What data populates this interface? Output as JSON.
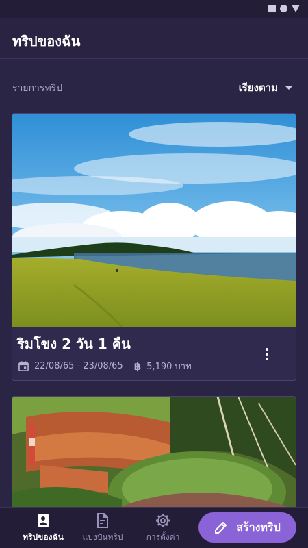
{
  "app": {
    "title": "ทริปของฉัน"
  },
  "list": {
    "label": "รายการทริป",
    "sort_label": "เรียงตาม"
  },
  "trips": [
    {
      "title": "ริมโขง 2 วัน 1 คืน",
      "dates": "22/08/65 - 23/08/65",
      "cost": "5,190 บาท",
      "date_icon": "calendar-icon",
      "cost_icon": "baht-icon"
    },
    {
      "title": "",
      "dates": "",
      "cost": ""
    }
  ],
  "bottom_nav": {
    "items": [
      {
        "label": "ทริปของฉัน",
        "icon": "portrait-icon",
        "active": true
      },
      {
        "label": "แบ่งปันทริป",
        "icon": "document-share-icon",
        "active": false
      },
      {
        "label": "การตั้งค่า",
        "icon": "gear-icon",
        "active": false
      }
    ]
  },
  "fab": {
    "label": "สร้างทริป",
    "icon": "pencil-icon"
  },
  "colors": {
    "background": "#2b2545",
    "card": "#312a4f",
    "accent": "#8a63d6",
    "muted_text": "#b7b1cf"
  }
}
